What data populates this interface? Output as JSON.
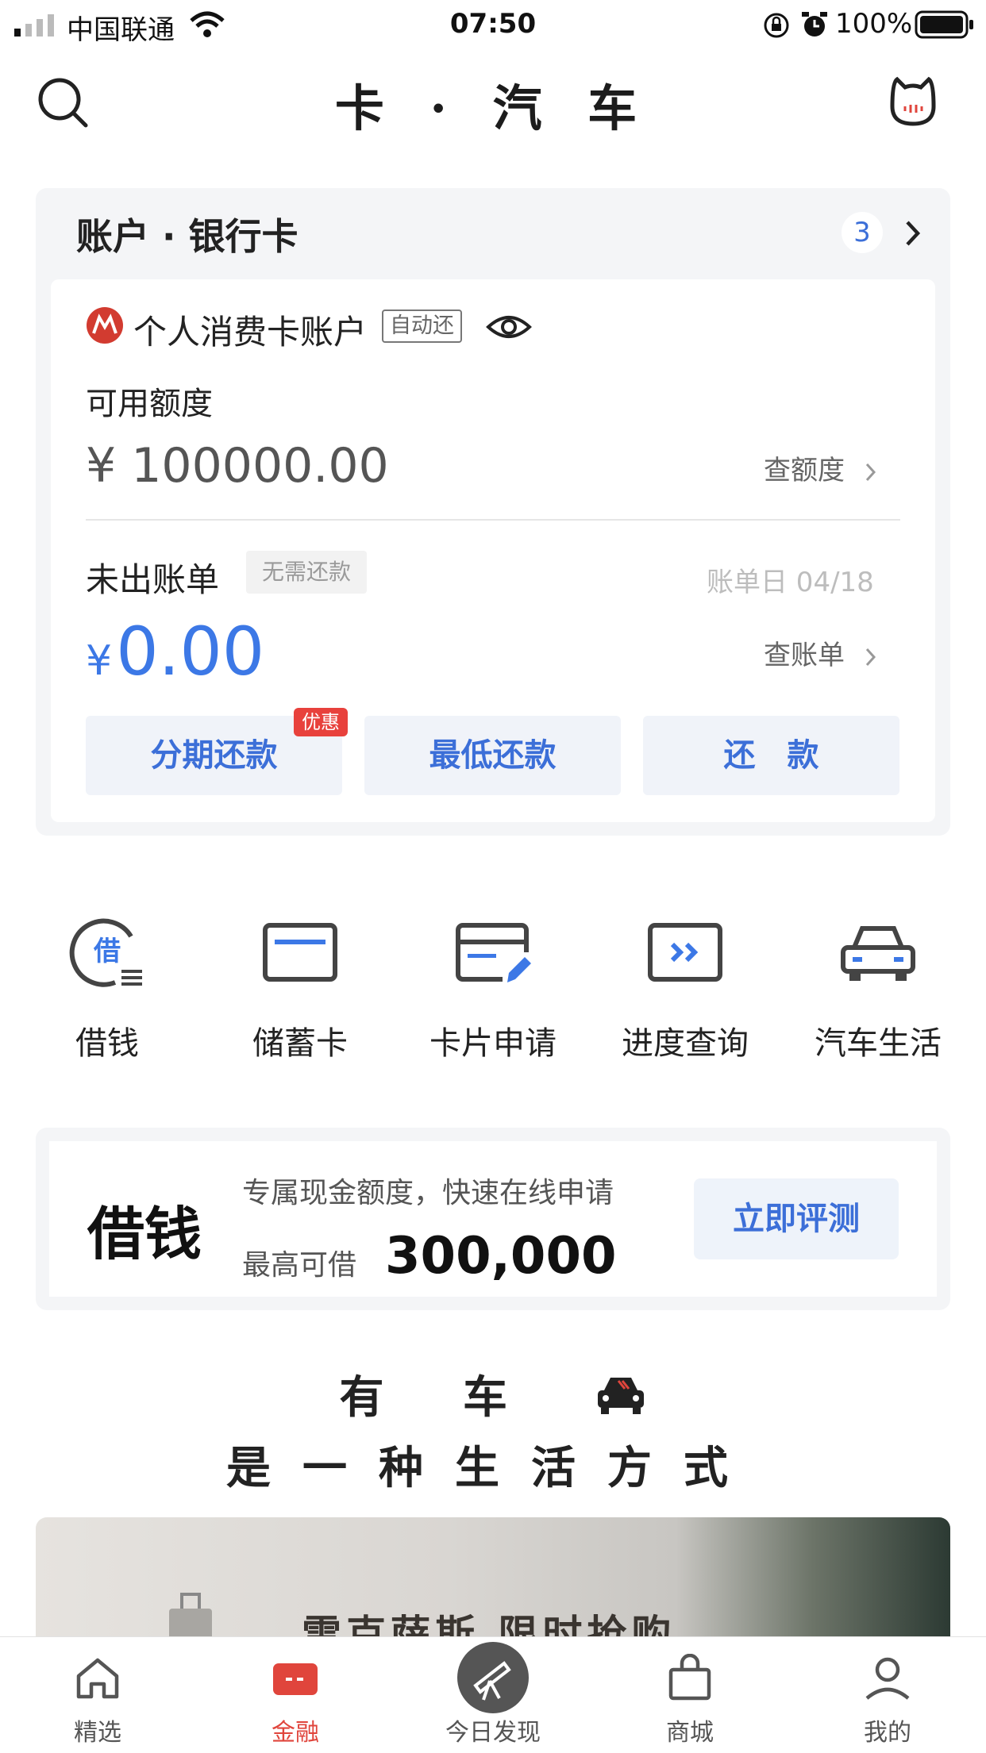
{
  "status_bar": {
    "carrier": "中国联通",
    "time": "07:50",
    "battery": "100%"
  },
  "header": {
    "title": "卡 · 汽 车"
  },
  "account_card": {
    "section_title": "账户 · 银行卡",
    "count": "3",
    "account_name": "个人消费卡账户",
    "autopay_tag": "自动还",
    "available_label": "可用额度",
    "available_amount": "¥ 100000.00",
    "check_limit": "查额度",
    "unbilled_label": "未出账单",
    "no_payment_tag": "无需还款",
    "bill_date": "账单日 04/18",
    "unbilled_symbol": "¥",
    "unbilled_amount": "0.00",
    "check_bill": "查账单",
    "buttons": {
      "installment": "分期还款",
      "installment_tag": "优惠",
      "minimum": "最低还款",
      "repay": "还　款"
    },
    "colors": {
      "accent": "#3c78e6",
      "tag_red": "#e8413c"
    }
  },
  "quick_entries": [
    {
      "label": "借钱",
      "icon": "borrow-icon"
    },
    {
      "label": "储蓄卡",
      "icon": "debit-card-icon"
    },
    {
      "label": "卡片申请",
      "icon": "card-apply-icon"
    },
    {
      "label": "进度查询",
      "icon": "progress-icon"
    },
    {
      "label": "汽车生活",
      "icon": "car-icon"
    }
  ],
  "loan_card": {
    "title": "借钱",
    "description": "专属现金额度，快速在线申请",
    "max_label": "最高可借",
    "max_amount": "300,000",
    "cta": "立即评测"
  },
  "slogan": {
    "line1": "有 车",
    "line2": "是一种生活方式"
  },
  "banner": {
    "text": "雷克萨斯 限时抢购"
  },
  "tab_bar": [
    {
      "label": "精选",
      "icon": "home-icon"
    },
    {
      "label": "金融",
      "icon": "wallet-icon",
      "active": true
    },
    {
      "label": "今日发现",
      "icon": "telescope-icon"
    },
    {
      "label": "商城",
      "icon": "shopping-bag-icon"
    },
    {
      "label": "我的",
      "icon": "profile-icon"
    }
  ]
}
